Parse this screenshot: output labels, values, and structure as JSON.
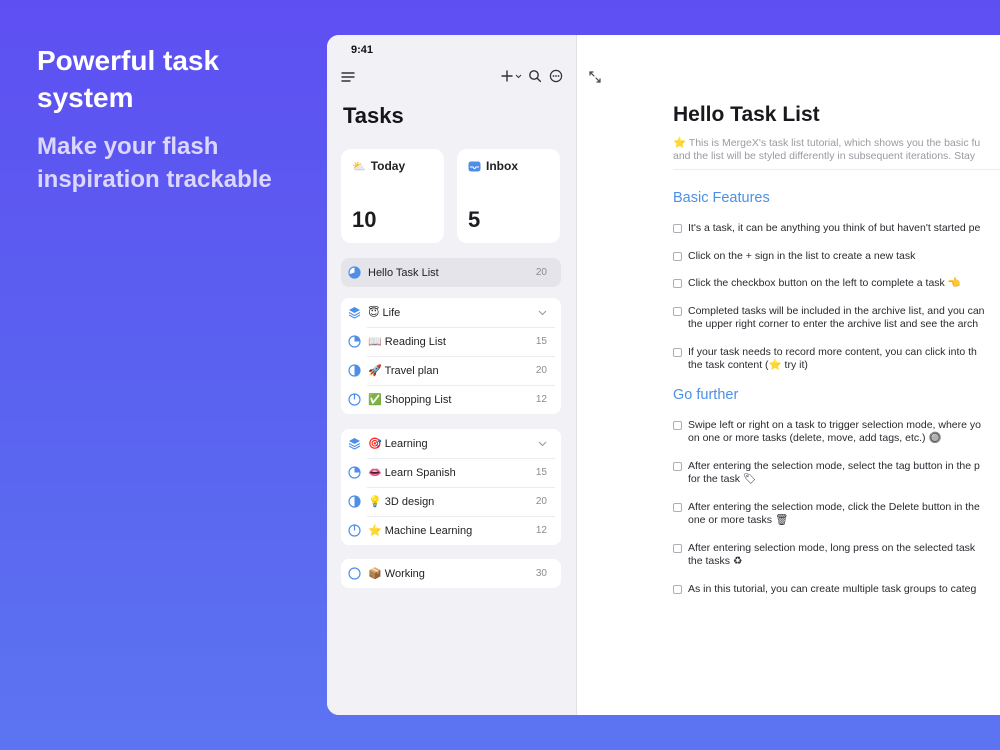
{
  "promo": {
    "title_line1": "Powerful task",
    "title_line2": "system",
    "sub_line1": "Make your flash",
    "sub_line2": "inspiration trackable"
  },
  "status": {
    "time": "9:41"
  },
  "sidebar": {
    "title": "Tasks",
    "icons": [
      "menu-icon",
      "plus-icon",
      "chevron-down-icon",
      "search-icon",
      "more-icon"
    ],
    "cards": [
      {
        "emoji": "⛅",
        "label": "Today",
        "count": "10"
      },
      {
        "emoji": "📥",
        "label": "Inbox",
        "count": "5"
      }
    ],
    "selected_list": {
      "label": "Hello Task List",
      "count": "20"
    },
    "groups": [
      {
        "emoji": "😇",
        "label": "Life",
        "items": [
          {
            "emoji": "📖",
            "label": "Reading List",
            "count": "15"
          },
          {
            "emoji": "🚀",
            "label": "Travel plan",
            "count": "20"
          },
          {
            "emoji": "✅",
            "label": "Shopping List",
            "count": "12"
          }
        ]
      },
      {
        "emoji": "🎯",
        "label": "Learning",
        "items": [
          {
            "emoji": "👄",
            "label": "Learn Spanish",
            "count": "15"
          },
          {
            "emoji": "💡",
            "label": "3D design",
            "count": "20"
          },
          {
            "emoji": "⭐",
            "label": "Machine Learning",
            "count": "12"
          }
        ]
      }
    ],
    "working": {
      "emoji": "📦",
      "label": "Working",
      "count": "30"
    }
  },
  "main": {
    "title": "Hello Task List",
    "intro_line1": "⭐ This is MergeX's task list tutorial, which shows you the basic fu",
    "intro_line2": "and the list will be styled differently in subsequent iterations. Stay",
    "section1": "Basic Features",
    "section1_tasks": [
      {
        "l1": "It's a task, it can be anything you think of but haven't started pe",
        "l2": ""
      },
      {
        "l1": "Click on the + sign in the list to create a new task",
        "l2": ""
      },
      {
        "l1": "Click the checkbox button on the left to complete a task 👈",
        "l2": ""
      },
      {
        "l1": "Completed tasks will be included in the archive list, and you can",
        "l2": "the upper right corner to enter the archive list and see the arch"
      },
      {
        "l1": "If your task needs to record more content, you can click into th",
        "l2": "the task content (⭐ try it)"
      }
    ],
    "section2": "Go further",
    "section2_tasks": [
      {
        "l1": "Swipe left or right on a task to trigger selection mode, where yo",
        "l2": "on one or more tasks (delete, move, add tags, etc.) 🔘"
      },
      {
        "l1": "After entering the selection mode, select the tag button in the p",
        "l2": "for the task 🏷"
      },
      {
        "l1": "After entering the selection mode, click the Delete button in the",
        "l2": "one or more tasks 🗑"
      },
      {
        "l1": "After entering selection mode, long press on the selected task",
        "l2": "the tasks ♻"
      },
      {
        "l1": "As in this tutorial, you can create multiple task groups to categ",
        "l2": ""
      }
    ]
  },
  "colors": {
    "background": "#5e4ff2",
    "accent": "#4d8fe8",
    "sidebar_bg": "#f2f2f6"
  }
}
